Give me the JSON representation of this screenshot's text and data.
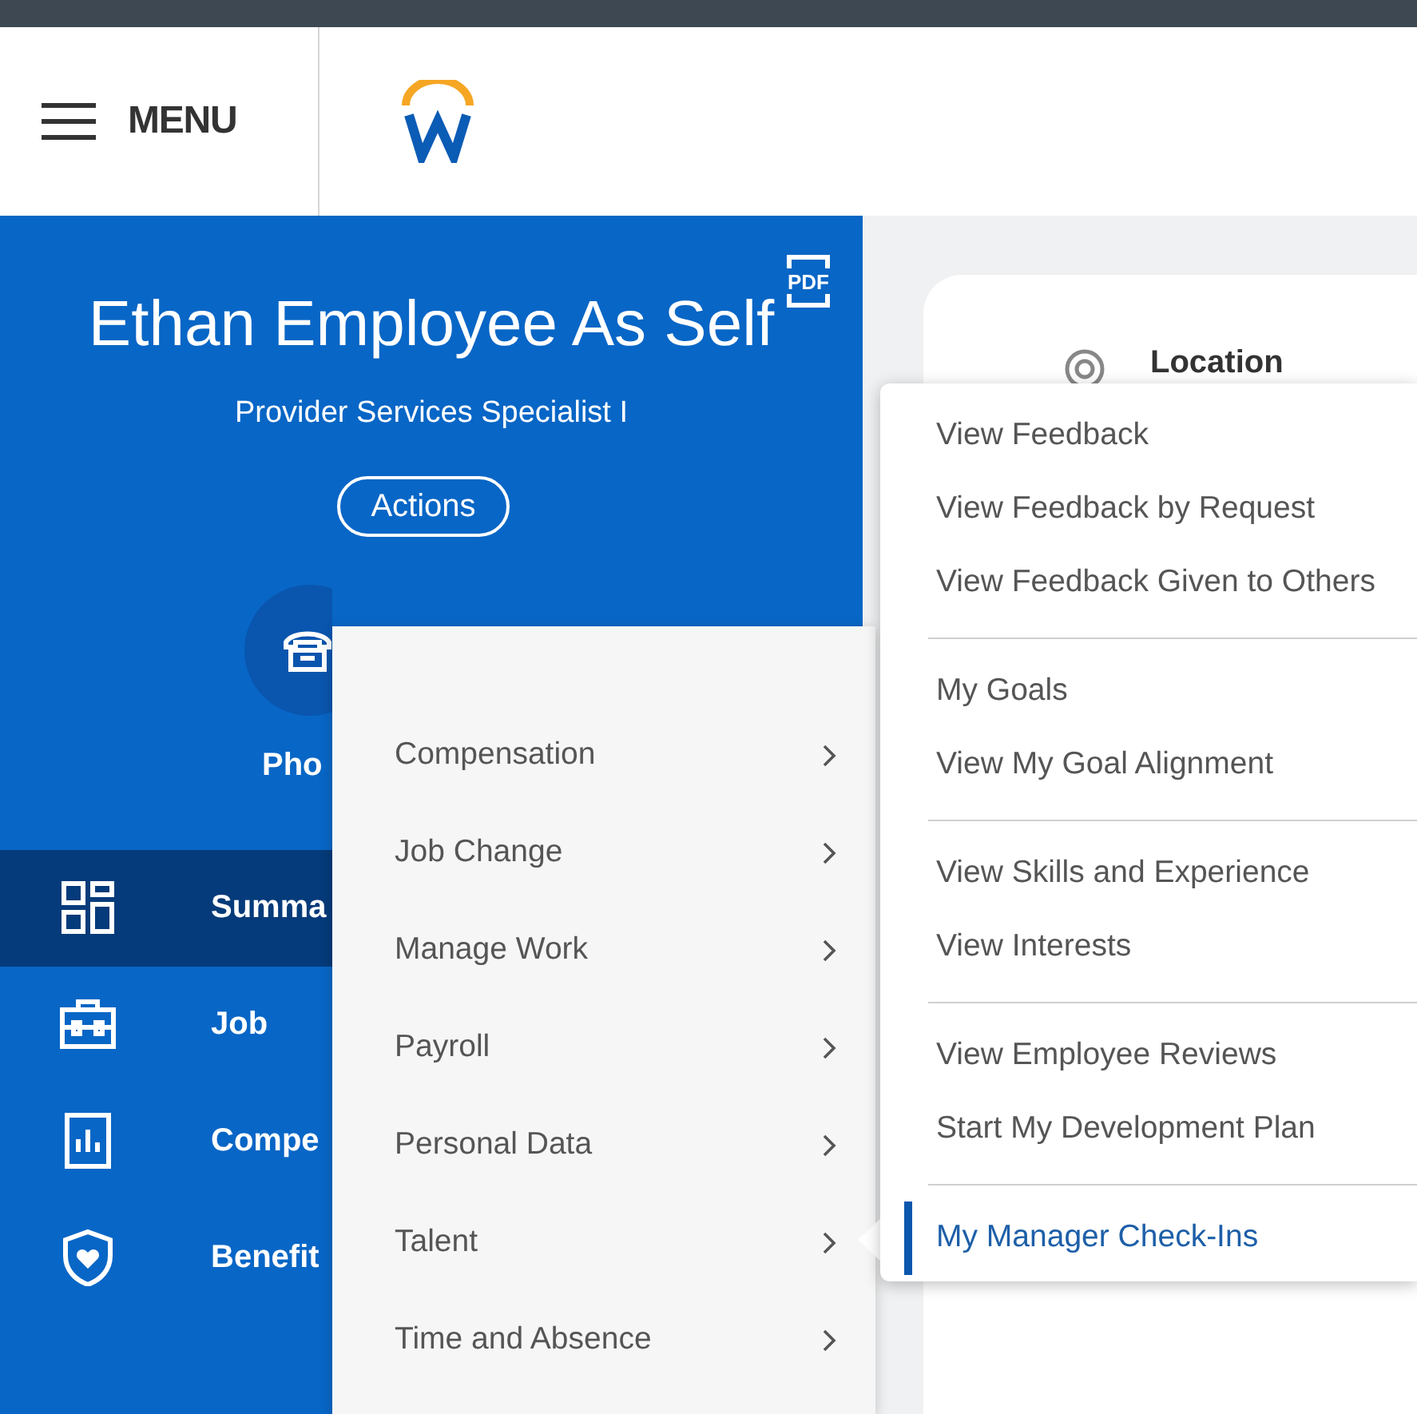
{
  "header": {
    "menu_label": "MENU"
  },
  "profile": {
    "pdf_label": "PDF",
    "name": "Ethan Employee As Self",
    "title": "Provider Services Specialist I",
    "actions_label": "Actions",
    "phone_label": "Pho"
  },
  "sidebar": {
    "items": [
      {
        "label": "Summa",
        "selected": true
      },
      {
        "label": "Job",
        "selected": false
      },
      {
        "label": "Compe",
        "selected": false
      },
      {
        "label": "Benefit",
        "selected": false
      }
    ]
  },
  "card": {
    "title": "Location"
  },
  "actions_menu": {
    "items": [
      "Compensation",
      "Job Change",
      "Manage Work",
      "Payroll",
      "Personal Data",
      "Talent",
      "Time and Absence"
    ]
  },
  "submenu": {
    "groups": [
      {
        "items": [
          {
            "label": "View Feedback",
            "selected": false
          },
          {
            "label": "View Feedback by Request",
            "selected": false
          },
          {
            "label": "View Feedback Given to Others",
            "selected": false
          }
        ]
      },
      {
        "items": [
          {
            "label": "My Goals",
            "selected": false
          },
          {
            "label": "View My Goal Alignment",
            "selected": false
          }
        ]
      },
      {
        "items": [
          {
            "label": "View Skills and Experience",
            "selected": false
          },
          {
            "label": "View Interests",
            "selected": false
          }
        ]
      },
      {
        "items": [
          {
            "label": "View Employee Reviews",
            "selected": false
          },
          {
            "label": "Start My Development Plan",
            "selected": false
          }
        ]
      },
      {
        "items": [
          {
            "label": "My Manager Check-Ins",
            "selected": true
          }
        ]
      }
    ]
  }
}
